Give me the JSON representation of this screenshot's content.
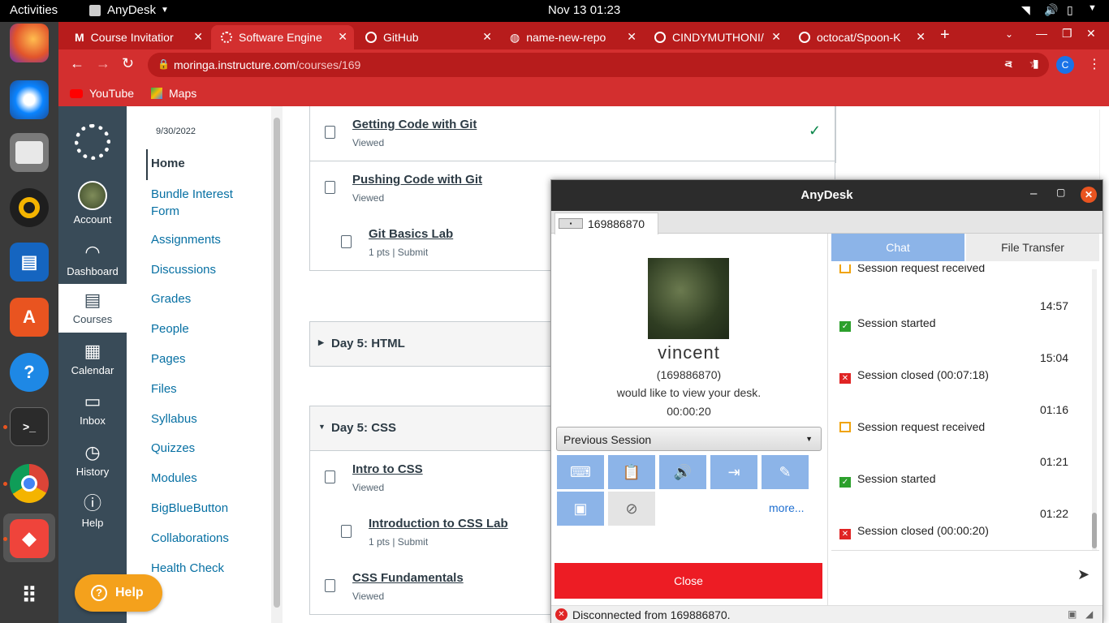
{
  "system": {
    "activities": "Activities",
    "app_name": "AnyDesk",
    "clock": "Nov 13  01:23"
  },
  "browser": {
    "tabs": [
      {
        "label": "Course Invitatior",
        "icon": "gmail-icon"
      },
      {
        "label": "Software Engine",
        "icon": "loading-icon"
      },
      {
        "label": "GitHub",
        "icon": "github-icon"
      },
      {
        "label": "name-new-repo",
        "icon": "globe-icon"
      },
      {
        "label": "CINDYMUTHONI/",
        "icon": "github-icon"
      },
      {
        "label": "octocat/Spoon-K",
        "icon": "github-icon"
      }
    ],
    "url_host": "moringa.instructure.com",
    "url_path": "/courses/169",
    "profile_letter": "C",
    "bookmarks": [
      {
        "label": "YouTube",
        "icon": "youtube-icon"
      },
      {
        "label": "Maps",
        "icon": "maps-icon"
      }
    ]
  },
  "global_nav": {
    "items": [
      {
        "label": "Account",
        "icon": "avatar"
      },
      {
        "label": "Dashboard",
        "icon": "dashboard-icon"
      },
      {
        "label": "Courses",
        "icon": "courses-icon"
      },
      {
        "label": "Calendar",
        "icon": "calendar-icon"
      },
      {
        "label": "Inbox",
        "icon": "inbox-icon"
      },
      {
        "label": "History",
        "icon": "clock-icon"
      },
      {
        "label": "Help",
        "icon": "help-icon"
      }
    ],
    "help_button": "Help"
  },
  "course_nav": {
    "date": "9/30/2022",
    "items": [
      "Home",
      "Bundle Interest Form",
      "Assignments",
      "Discussions",
      "Grades",
      "People",
      "Pages",
      "Files",
      "Syllabus",
      "Quizzes",
      "Modules",
      "BigBlueButton",
      "Collaborations",
      "Health Check"
    ]
  },
  "modules": {
    "items": [
      {
        "title": "Getting Code with Git",
        "sub": "Viewed"
      },
      {
        "title": "Pushing Code with Git",
        "sub": "Viewed"
      },
      {
        "title": "Git Basics Lab",
        "sub": "1 pts  |  Submit"
      },
      {
        "title": "Intro to CSS",
        "sub": "Viewed"
      },
      {
        "title": "Introduction to CSS Lab",
        "sub": "1 pts  |  Submit"
      },
      {
        "title": "CSS Fundamentals",
        "sub": "Viewed"
      }
    ],
    "headers": [
      "Day 5: HTML",
      "Day 5: CSS"
    ]
  },
  "anydesk": {
    "title": "AnyDesk",
    "tab_id": "169886870",
    "user_name": "vincent",
    "user_id": "(169886870)",
    "message": "would like to view your desk.",
    "timer": "00:00:20",
    "dropdown": "Previous Session",
    "more": "more...",
    "close_button": "Close",
    "chat_tab": "Chat",
    "file_tab": "File Transfer",
    "log": [
      {
        "time": "",
        "text": "Session request received",
        "kind": "request"
      },
      {
        "time": "14:57",
        "text": "Session started",
        "kind": "start"
      },
      {
        "time": "15:04",
        "text": "Session closed (00:07:18)",
        "kind": "closed"
      },
      {
        "time": "01:16",
        "text": "Session request received",
        "kind": "request"
      },
      {
        "time": "01:21",
        "text": "Session started",
        "kind": "start"
      },
      {
        "time": "01:22",
        "text": "Session closed (00:00:20)",
        "kind": "closed"
      }
    ],
    "status": "Disconnected from 169886870.",
    "colors": {
      "close": "#ed1c24",
      "action": "#8cb4e8",
      "chat_tab": "#8cb4e8"
    }
  }
}
